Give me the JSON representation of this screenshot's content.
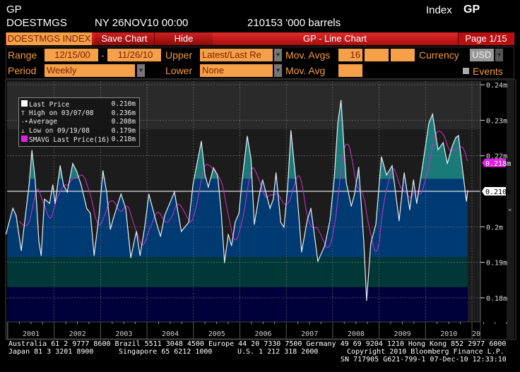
{
  "header": {
    "function_code": "GP",
    "ticker": "DOESTMGS",
    "market_time": "NY 26NOV10 00:00",
    "last_value": "210153 '000 barrels",
    "index_label": "Index",
    "index_code": "GP"
  },
  "toolbar": {
    "security": "DOESTMGS INDEX",
    "save_chart": "Save Chart",
    "hide": "Hide",
    "title": "GP - Line Chart",
    "page": "Page 1/15"
  },
  "controls": {
    "range_label": "Range",
    "range_start": "12/15/00",
    "range_sep": "-",
    "range_end": "11/26/10",
    "upper_label": "Upper",
    "upper_value": "Latest/Last Re",
    "mov_avgs_label": "Mov. Avgs",
    "mov_avgs": [
      "16",
      "",
      ""
    ],
    "currency_label": "Currency",
    "currency_value": "USD",
    "period_label": "Period",
    "period_value": "Weekly",
    "lower_label": "Lower",
    "lower_value": "None",
    "mov_avg_label": "Mov. Avg",
    "mov_avg_value": "",
    "events_label": "Events"
  },
  "legend": [
    {
      "label": "Last Price",
      "value": "0.210m"
    },
    {
      "label": "High on 03/07/08",
      "value": "0.236m"
    },
    {
      "label": "Average",
      "value": "0.208m"
    },
    {
      "label": "Low on 09/19/08",
      "value": "0.179m"
    },
    {
      "label": "SMAVG Last Price(16)",
      "value": "0.218m"
    }
  ],
  "footer": {
    "line1": "Australia 61 2 9777 8600 Brazil 5511 3048 4500 Europe 44 20 7330 7500 Germany 49 69 9204 1210 Hong Kong 852 2977 6000",
    "line2a": "Japan 81 3 3201 8900",
    "line2b": "Singapore 65 6212 1000",
    "line2c": "U.S. 1 212 318 2000",
    "line2d": "Copyright 2010 Bloomberg Finance L.P.",
    "line3": "SN 717905 G621-799-1 07-Dec-10 12:33:10"
  },
  "colors": {
    "line": "#e8f0f8",
    "sma": "#c030c0",
    "band_high": "#1a7a78",
    "band_mid": "#003a72",
    "band_low": "#003838",
    "band_bottom": "#00003a",
    "orange": "#f7a04a"
  },
  "chart_data": {
    "type": "area",
    "title": "GP - Line Chart",
    "unit": "m",
    "xlabel": "",
    "ylabel": "",
    "xlim": [
      2000.96,
      2011.18
    ],
    "ylim": [
      0.1734,
      0.2431
    ],
    "y_ticks": [
      {
        "value": 0.24,
        "label": "0.24m"
      },
      {
        "value": 0.23,
        "label": "0.23m"
      },
      {
        "value": 0.22,
        "label": "0.22m"
      },
      {
        "value": 0.2,
        "label": "0.2m"
      },
      {
        "value": 0.19,
        "label": "0.19m"
      },
      {
        "value": 0.18,
        "label": "0.18m"
      }
    ],
    "x_ticks": [
      "2001",
      "2002",
      "2003",
      "2004",
      "2005",
      "2006",
      "2007",
      "2008",
      "2009",
      "2010",
      "20"
    ],
    "grid": true,
    "legend_position": "top-left",
    "last_price": 0.21,
    "last_price_label": "0.210m",
    "sma_last": 0.218,
    "sma_last_label": "0.218m",
    "sma_period": 16,
    "average": 0.208,
    "high": 0.236,
    "low": 0.179,
    "series": [
      {
        "name": "Last Price",
        "points": [
          [
            2000.96,
            0.1979
          ],
          [
            2001.11,
            0.2052
          ],
          [
            2001.18,
            0.2032
          ],
          [
            2001.29,
            0.1933
          ],
          [
            2001.38,
            0.2032
          ],
          [
            2001.46,
            0.2118
          ],
          [
            2001.52,
            0.2215
          ],
          [
            2001.59,
            0.2132
          ],
          [
            2001.67,
            0.1959
          ],
          [
            2001.72,
            0.1919
          ],
          [
            2001.79,
            0.2078
          ],
          [
            2001.9,
            0.2066
          ],
          [
            2001.97,
            0.2118
          ],
          [
            2002.02,
            0.2066
          ],
          [
            2002.13,
            0.2172
          ],
          [
            2002.2,
            0.2118
          ],
          [
            2002.28,
            0.2098
          ],
          [
            2002.4,
            0.2178
          ],
          [
            2002.48,
            0.2158
          ],
          [
            2002.58,
            0.2118
          ],
          [
            2002.7,
            0.2052
          ],
          [
            2002.78,
            0.2038
          ],
          [
            2002.86,
            0.1919
          ],
          [
            2002.96,
            0.2026
          ],
          [
            2003.05,
            0.2158
          ],
          [
            2003.13,
            0.2098
          ],
          [
            2003.21,
            0.1993
          ],
          [
            2003.28,
            0.2026
          ],
          [
            2003.44,
            0.2092
          ],
          [
            2003.54,
            0.2052
          ],
          [
            2003.65,
            0.1913
          ],
          [
            2003.77,
            0.1987
          ],
          [
            2003.85,
            0.1919
          ],
          [
            2003.95,
            0.1999
          ],
          [
            2004.04,
            0.2092
          ],
          [
            2004.2,
            0.2013
          ],
          [
            2004.29,
            0.1973
          ],
          [
            2004.38,
            0.2032
          ],
          [
            2004.59,
            0.2098
          ],
          [
            2004.74,
            0.1987
          ],
          [
            2004.9,
            0.2013
          ],
          [
            2004.99,
            0.2118
          ],
          [
            2005.06,
            0.2166
          ],
          [
            2005.17,
            0.2241
          ],
          [
            2005.25,
            0.2146
          ],
          [
            2005.32,
            0.2112
          ],
          [
            2005.43,
            0.2166
          ],
          [
            2005.52,
            0.2146
          ],
          [
            2005.6,
            0.2038
          ],
          [
            2005.67,
            0.1899
          ],
          [
            2005.75,
            0.1979
          ],
          [
            2005.82,
            0.1947
          ],
          [
            2005.9,
            0.2013
          ],
          [
            2005.98,
            0.2038
          ],
          [
            2006.05,
            0.2132
          ],
          [
            2006.16,
            0.2255
          ],
          [
            2006.24,
            0.2191
          ],
          [
            2006.31,
            0.2007
          ],
          [
            2006.42,
            0.2092
          ],
          [
            2006.49,
            0.2132
          ],
          [
            2006.57,
            0.2092
          ],
          [
            2006.65,
            0.2052
          ],
          [
            2006.72,
            0.2078
          ],
          [
            2006.78,
            0.2152
          ],
          [
            2006.88,
            0.2013
          ],
          [
            2006.95,
            0.1999
          ],
          [
            2007.03,
            0.2112
          ],
          [
            2007.1,
            0.2271
          ],
          [
            2007.23,
            0.2098
          ],
          [
            2007.33,
            0.1929
          ],
          [
            2007.45,
            0.2018
          ],
          [
            2007.53,
            0.2052
          ],
          [
            2007.68,
            0.1903
          ],
          [
            2007.83,
            0.1947
          ],
          [
            2007.94,
            0.2018
          ],
          [
            2008.03,
            0.2132
          ],
          [
            2008.11,
            0.2291
          ],
          [
            2008.18,
            0.2356
          ],
          [
            2008.29,
            0.2126
          ],
          [
            2008.4,
            0.2058
          ],
          [
            2008.47,
            0.2092
          ],
          [
            2008.56,
            0.2168
          ],
          [
            2008.67,
            0.1959
          ],
          [
            2008.73,
            0.1792
          ],
          [
            2008.82,
            0.1953
          ],
          [
            2008.93,
            0.2007
          ],
          [
            2009.05,
            0.2197
          ],
          [
            2009.16,
            0.2146
          ],
          [
            2009.28,
            0.2172
          ],
          [
            2009.43,
            0.2017
          ],
          [
            2009.54,
            0.2152
          ],
          [
            2009.66,
            0.2048
          ],
          [
            2009.74,
            0.2132
          ],
          [
            2009.81,
            0.2066
          ],
          [
            2009.93,
            0.2166
          ],
          [
            2010.07,
            0.2291
          ],
          [
            2010.15,
            0.2317
          ],
          [
            2010.27,
            0.2217
          ],
          [
            2010.38,
            0.2237
          ],
          [
            2010.47,
            0.2178
          ],
          [
            2010.57,
            0.2225
          ],
          [
            2010.65,
            0.2251
          ],
          [
            2010.71,
            0.2257
          ],
          [
            2010.8,
            0.2158
          ],
          [
            2010.88,
            0.2072
          ],
          [
            2010.91,
            0.2102
          ]
        ]
      }
    ],
    "bands": [
      0.2135,
      0.1915,
      0.183
    ]
  }
}
